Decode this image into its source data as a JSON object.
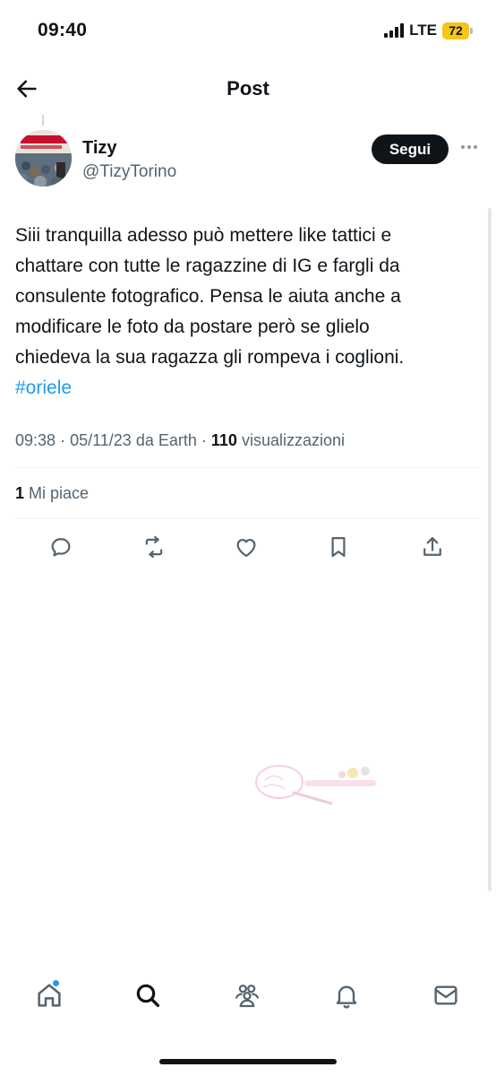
{
  "status_bar": {
    "time": "09:40",
    "network": "LTE",
    "battery": "72",
    "battery_color": "#f5c518"
  },
  "header": {
    "title": "Post",
    "back_icon": "arrow-left-icon"
  },
  "post": {
    "author": {
      "name": "Tizy",
      "handle": "@TizyTorino"
    },
    "follow_label": "Segui",
    "text_lines": [
      "Siii tranquilla adesso può mettere like tattici e",
      "chattare con tutte le ragazzine di IG e fargli da",
      "consulente fotografico. Pensa le aiuta anche a",
      "modificare le foto da postare però se glielo",
      "chiedeva la sua ragazza gli rompeva i coglioni."
    ],
    "hashtag": "#oriele",
    "meta": {
      "time": "09:38",
      "date": "05/11/23",
      "source": "da Earth",
      "views_count": "110",
      "views_label": "visualizzazioni"
    },
    "likes": {
      "count": "1",
      "label": "Mi piace"
    },
    "actions": [
      "reply-icon",
      "repost-icon",
      "like-icon",
      "bookmark-icon",
      "share-icon"
    ]
  },
  "bottom_nav": {
    "items": [
      "home-icon",
      "search-icon",
      "communities-icon",
      "notifications-icon",
      "messages-icon"
    ],
    "home_has_badge": true
  },
  "colors": {
    "accent": "#1d9bf0",
    "text": "#0f1419",
    "secondary_text": "#536471",
    "follow_button": "#0f1419"
  }
}
